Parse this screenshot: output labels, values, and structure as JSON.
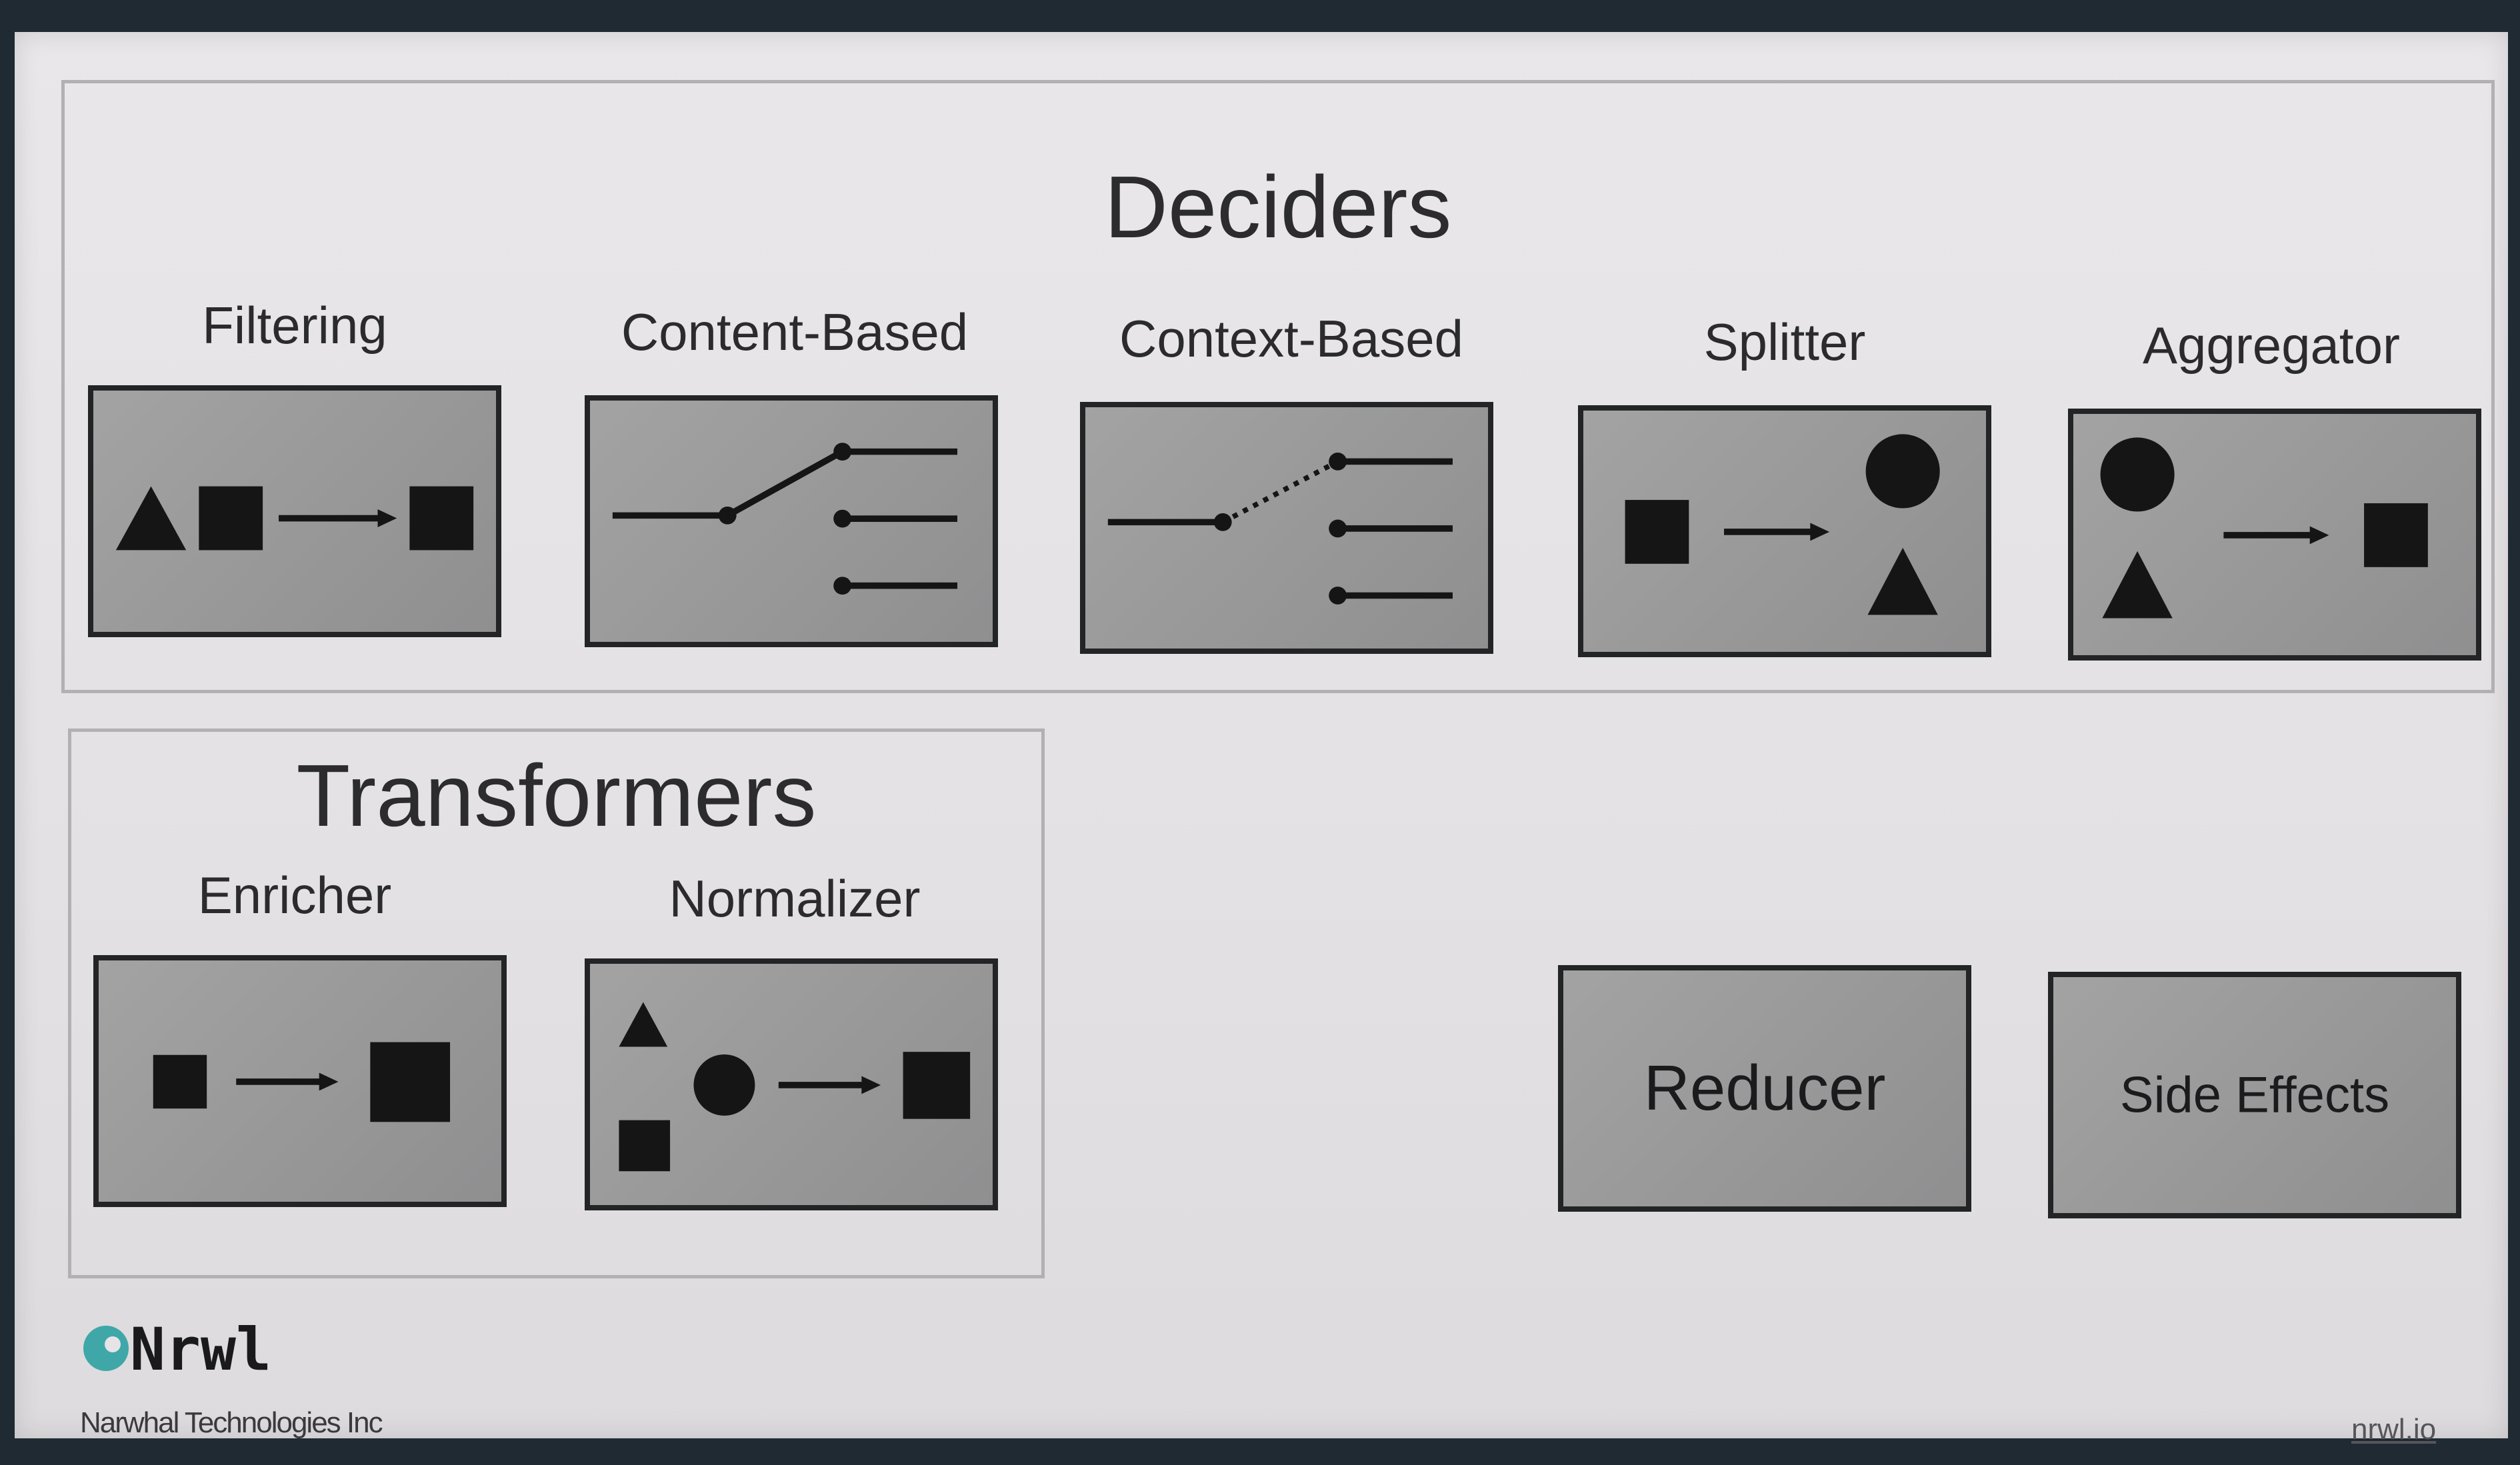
{
  "deciders": {
    "title": "Deciders",
    "items": [
      {
        "label": "Filtering"
      },
      {
        "label": "Content-Based"
      },
      {
        "label": "Context-Based"
      },
      {
        "label": "Splitter"
      },
      {
        "label": "Aggregator"
      }
    ]
  },
  "transformers": {
    "title": "Transformers",
    "items": [
      {
        "label": "Enricher"
      },
      {
        "label": "Normalizer"
      }
    ]
  },
  "standalone": {
    "reducer": "Reducer",
    "side_effects": "Side Effects"
  },
  "footer": {
    "logo_text": "Nrwl",
    "company": "Narwhal Technologies Inc",
    "site": "nrwl.io"
  },
  "colors": {
    "tile_fill": "#9a9a9b",
    "tile_border": "#222426",
    "background": "#e6e4e6",
    "logo_accent": "#3fa7a8"
  }
}
